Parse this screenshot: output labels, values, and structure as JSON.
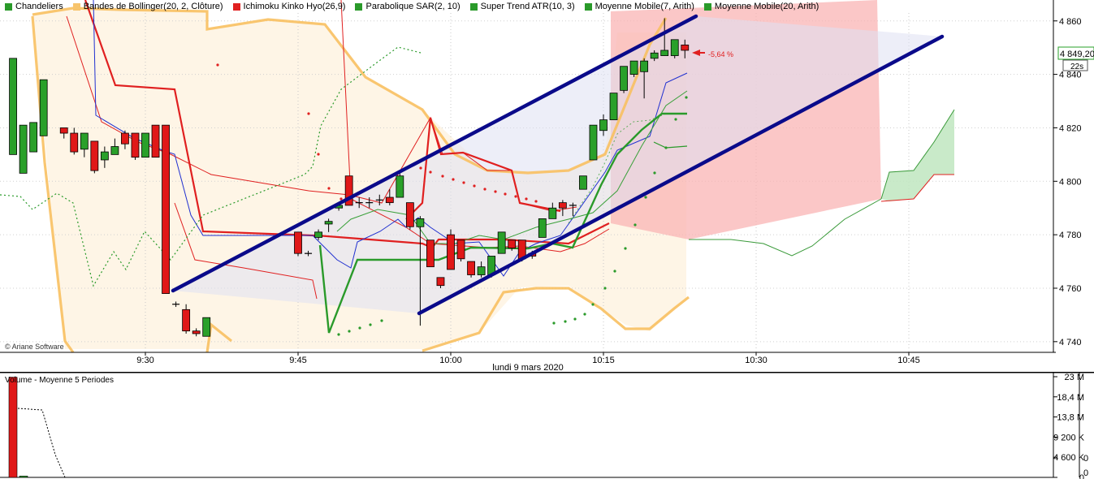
{
  "legend": [
    {
      "label": "Chandeliers",
      "color": "#2a9a2a"
    },
    {
      "label": "Bandes de Bollinger(20, 2, Clôture)",
      "color": "#f7c46c"
    },
    {
      "label": "Ichimoku Kinko Hyo(26,9)",
      "color": "#e02020"
    },
    {
      "label": "Parabolique SAR(2, 10)",
      "color": "#2a9a2a"
    },
    {
      "label": "Super Trend ATR(10, 3)",
      "color": "#2a9a2a"
    },
    {
      "label": "Moyenne Mobile(7, Arith)",
      "color": "#2a9a2a"
    },
    {
      "label": "Moyenne Mobile(20, Arith)",
      "color": "#2a9a2a"
    }
  ],
  "copyright": "© Ariane Software",
  "date_label": "lundi 9 mars 2020",
  "price_badge": "4 849,20",
  "timer_badge": "22s",
  "change_label": "-5,64 %",
  "volume_title": "Volume  - Moyenne 5 Periodes",
  "colors": {
    "up": "#2aa02a",
    "down": "#e01818",
    "channel": "#0a0a8a",
    "bollinger": "#f8c060",
    "sar": "#2a9a2a",
    "ichimoku": "#e02020",
    "cloud_red": "#f9b4b4",
    "cloud_green": "#bfe6bf"
  },
  "chart_data": [
    {
      "type": "candlestick",
      "title": "",
      "x_ticks": [
        "9:30",
        "9:45",
        "10:00",
        "10:15",
        "10:30",
        "10:45"
      ],
      "y_ticks": [
        "4 860",
        "4 840",
        "4 820",
        "4 800",
        "4 780",
        "4 760",
        "4 740"
      ],
      "ylim": [
        4736,
        4866
      ],
      "interval_minutes": 1,
      "candles": [
        {
          "t": "9:17",
          "o": 4810,
          "h": 4846,
          "l": 4810,
          "c": 4846
        },
        {
          "t": "9:18",
          "o": 4803,
          "h": 4821,
          "l": 4803,
          "c": 4821
        },
        {
          "t": "9:19",
          "o": 4811,
          "h": 4822,
          "l": 4811,
          "c": 4822
        },
        {
          "t": "9:20",
          "o": 4817,
          "h": 4838,
          "l": 4817,
          "c": 4838
        },
        {
          "t": "9:22",
          "o": 4820,
          "h": 4820,
          "l": 4816,
          "c": 4818
        },
        {
          "t": "9:23",
          "o": 4818,
          "h": 4820,
          "l": 4810,
          "c": 4811
        },
        {
          "t": "9:24",
          "o": 4812,
          "h": 4818,
          "l": 4809,
          "c": 4818
        },
        {
          "t": "9:25",
          "o": 4815,
          "h": 4815,
          "l": 4803,
          "c": 4804
        },
        {
          "t": "9:26",
          "o": 4808,
          "h": 4813,
          "l": 4805,
          "c": 4811
        },
        {
          "t": "9:27",
          "o": 4810,
          "h": 4816,
          "l": 4810,
          "c": 4813
        },
        {
          "t": "9:28",
          "o": 4818,
          "h": 4819,
          "l": 4812,
          "c": 4814
        },
        {
          "t": "9:29",
          "o": 4818,
          "h": 4818,
          "l": 4808,
          "c": 4809
        },
        {
          "t": "9:30",
          "o": 4809,
          "h": 4818,
          "l": 4809,
          "c": 4818
        },
        {
          "t": "9:31",
          "o": 4821,
          "h": 4821,
          "l": 4809,
          "c": 4809
        },
        {
          "t": "9:32",
          "o": 4821,
          "h": 4821,
          "l": 4758,
          "c": 4758
        },
        {
          "t": "9:33",
          "o": 4754,
          "h": 4755,
          "l": 4753,
          "c": 4754
        },
        {
          "t": "9:34",
          "o": 4752,
          "h": 4754,
          "l": 4743,
          "c": 4744
        },
        {
          "t": "9:35",
          "o": 4744,
          "h": 4745,
          "l": 4742,
          "c": 4743
        },
        {
          "t": "9:36",
          "o": 4742,
          "h": 4749,
          "l": 4742,
          "c": 4749
        },
        {
          "t": "9:45",
          "o": 4781,
          "h": 4781,
          "l": 4772,
          "c": 4773
        },
        {
          "t": "9:46",
          "o": 4773,
          "h": 4774,
          "l": 4772,
          "c": 4773
        },
        {
          "t": "9:47",
          "o": 4779,
          "h": 4782,
          "l": 4778,
          "c": 4781
        },
        {
          "t": "9:48",
          "o": 4784,
          "h": 4786,
          "l": 4781,
          "c": 4785
        },
        {
          "t": "9:49",
          "o": 4790,
          "h": 4792,
          "l": 4789,
          "c": 4791
        },
        {
          "t": "9:50",
          "o": 4802,
          "h": 4802,
          "l": 4791,
          "c": 4791
        },
        {
          "t": "9:51",
          "o": 4792,
          "h": 4794,
          "l": 4790,
          "c": 4792
        },
        {
          "t": "9:52",
          "o": 4792,
          "h": 4794,
          "l": 4790,
          "c": 4792
        },
        {
          "t": "9:53",
          "o": 4793,
          "h": 4795,
          "l": 4791,
          "c": 4793
        },
        {
          "t": "9:54",
          "o": 4794,
          "h": 4797,
          "l": 4791,
          "c": 4792
        },
        {
          "t": "9:55",
          "o": 4794,
          "h": 4803,
          "l": 4794,
          "c": 4802
        },
        {
          "t": "9:56",
          "o": 4792,
          "h": 4792,
          "l": 4782,
          "c": 4783
        },
        {
          "t": "9:57",
          "o": 4783,
          "h": 4787,
          "l": 4746,
          "c": 4786
        },
        {
          "t": "9:58",
          "o": 4778,
          "h": 4778,
          "l": 4768,
          "c": 4768
        },
        {
          "t": "9:59",
          "o": 4764,
          "h": 4764,
          "l": 4760,
          "c": 4761
        },
        {
          "t": "10:00",
          "o": 4780,
          "h": 4782,
          "l": 4767,
          "c": 4767
        },
        {
          "t": "10:01",
          "o": 4778,
          "h": 4778,
          "l": 4770,
          "c": 4771
        },
        {
          "t": "10:02",
          "o": 4770,
          "h": 4770,
          "l": 4764,
          "c": 4765
        },
        {
          "t": "10:03",
          "o": 4765,
          "h": 4770,
          "l": 4764,
          "c": 4768
        },
        {
          "t": "10:04",
          "o": 4765,
          "h": 4772,
          "l": 4764,
          "c": 4772
        },
        {
          "t": "10:05",
          "o": 4773,
          "h": 4781,
          "l": 4773,
          "c": 4781
        },
        {
          "t": "10:06",
          "o": 4778,
          "h": 4778,
          "l": 4774,
          "c": 4775
        },
        {
          "t": "10:07",
          "o": 4778,
          "h": 4778,
          "l": 4770,
          "c": 4771
        },
        {
          "t": "10:08",
          "o": 4773,
          "h": 4774,
          "l": 4771,
          "c": 4772
        },
        {
          "t": "10:09",
          "o": 4779,
          "h": 4784,
          "l": 4779,
          "c": 4786
        },
        {
          "t": "10:10",
          "o": 4786,
          "h": 4792,
          "l": 4786,
          "c": 4790
        },
        {
          "t": "10:11",
          "o": 4792,
          "h": 4793,
          "l": 4787,
          "c": 4790
        },
        {
          "t": "10:12",
          "o": 4791,
          "h": 4792,
          "l": 4787,
          "c": 4791
        },
        {
          "t": "10:13",
          "o": 4797,
          "h": 4802,
          "l": 4797,
          "c": 4802
        },
        {
          "t": "10:14",
          "o": 4808,
          "h": 4821,
          "l": 4808,
          "c": 4821
        },
        {
          "t": "10:15",
          "o": 4819,
          "h": 4825,
          "l": 4817,
          "c": 4823
        },
        {
          "t": "10:16",
          "o": 4823,
          "h": 4833,
          "l": 4823,
          "c": 4833
        },
        {
          "t": "10:17",
          "o": 4834,
          "h": 4843,
          "l": 4833,
          "c": 4843
        },
        {
          "t": "10:18",
          "o": 4840,
          "h": 4845,
          "l": 4839,
          "c": 4845
        },
        {
          "t": "10:19",
          "o": 4841,
          "h": 4846,
          "l": 4831,
          "c": 4845
        },
        {
          "t": "10:20",
          "o": 4846,
          "h": 4849,
          "l": 4845,
          "c": 4848
        },
        {
          "t": "10:21",
          "o": 4847,
          "h": 4861,
          "l": 4847,
          "c": 4849
        },
        {
          "t": "10:22",
          "o": 4847,
          "h": 4853,
          "l": 4846,
          "c": 4853
        },
        {
          "t": "10:23",
          "o": 4851,
          "h": 4853,
          "l": 4846,
          "c": 4849
        }
      ]
    },
    {
      "type": "bar",
      "title": "Volume  - Moyenne 5 Periodes",
      "y_ticks": [
        "23 M",
        "18,4 M",
        "13,8 M",
        "9 200 K",
        "4 600 K",
        "0"
      ],
      "right_ticks": [
        "0",
        "0"
      ],
      "ylim": [
        0,
        23000000
      ],
      "values": [
        22900000,
        300000
      ]
    }
  ]
}
